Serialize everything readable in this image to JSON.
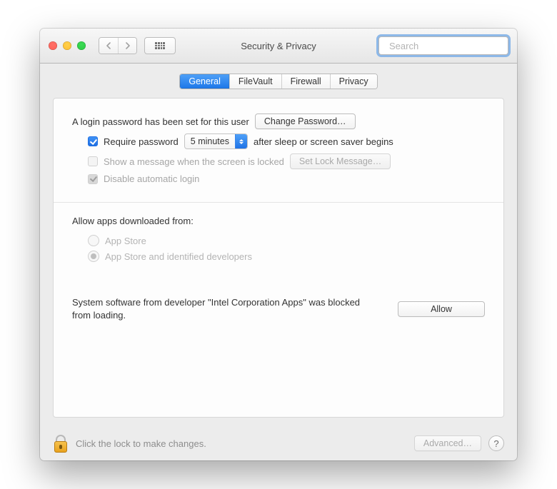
{
  "title": "Security & Privacy",
  "search": {
    "placeholder": "Search",
    "value": ""
  },
  "tabs": [
    {
      "label": "General",
      "active": true
    },
    {
      "label": "FileVault",
      "active": false
    },
    {
      "label": "Firewall",
      "active": false
    },
    {
      "label": "Privacy",
      "active": false
    }
  ],
  "general": {
    "login_pw_label": "A login password has been set for this user",
    "change_pw_btn": "Change Password…",
    "require_pw_checked": true,
    "require_pw_label": "Require password",
    "require_pw_select": "5 minutes",
    "require_pw_suffix": "after sleep or screen saver begins",
    "show_msg_checked": false,
    "show_msg_label": "Show a message when the screen is locked",
    "set_lock_msg_btn": "Set Lock Message…",
    "disable_auto_login_checked": true,
    "disable_auto_login_label": "Disable automatic login"
  },
  "gatekeeper": {
    "title": "Allow apps downloaded from:",
    "options": [
      {
        "label": "App Store",
        "selected": false
      },
      {
        "label": "App Store and identified developers",
        "selected": true
      }
    ]
  },
  "blocked": {
    "message": "System software from developer \"Intel Corporation Apps\" was blocked from loading.",
    "allow_btn": "Allow"
  },
  "footer": {
    "lock_text": "Click the lock to make changes.",
    "advanced_btn": "Advanced…",
    "help": "?"
  }
}
